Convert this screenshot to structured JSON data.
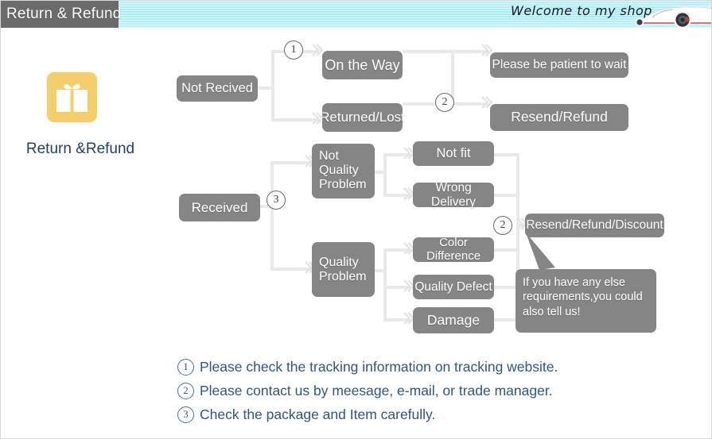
{
  "header": {
    "tab_label": "Return & Refund",
    "welcome_text": "Welcome to my shop",
    "tab_bg": "#6b6b6b",
    "banner_bg": "#a8ecfa",
    "car_icon": "sports-car-image"
  },
  "brand": {
    "icon": "gift-box-icon",
    "icon_color": "#f4ce6a",
    "label": "Return &Refund",
    "label_color": "#243f66"
  },
  "flow": {
    "box_color": "#858585",
    "line_color": "#e9e9e9",
    "nodes": {
      "not_received": "Not Recived",
      "on_the_way": "On the Way",
      "returned_lost": "Returned/Lost",
      "please_wait": "Please be patient to wait",
      "resend_refund": "Resend/Refund",
      "received": "Received",
      "not_quality_problem": "Not\nQuality\nProblem",
      "not_quality_problem_lines": [
        "Not",
        "Quality",
        "Problem"
      ],
      "quality_problem_lines": [
        "Quality",
        "Problem"
      ],
      "not_fit": "Not fit",
      "wrong_delivery": "Wrong Delivery",
      "color_difference": "Color Difference",
      "quality_defect": "Quality Defect",
      "damage": "Damage",
      "resend_refund_discount": "Resend/Refund/Discount"
    },
    "markers": {
      "m1": "1",
      "m2_top": "2",
      "m3": "3",
      "m2_right": "2"
    }
  },
  "callout": {
    "text": "If you have any else requirements,you could also tell us!",
    "bg": "#858585"
  },
  "notes": [
    {
      "num": "1",
      "text": "Please check the tracking information on tracking website."
    },
    {
      "num": "2",
      "text": "Please contact us by meesage, e-mail, or trade manager."
    },
    {
      "num": "3",
      "text": "Check the package and Item carefully."
    }
  ]
}
